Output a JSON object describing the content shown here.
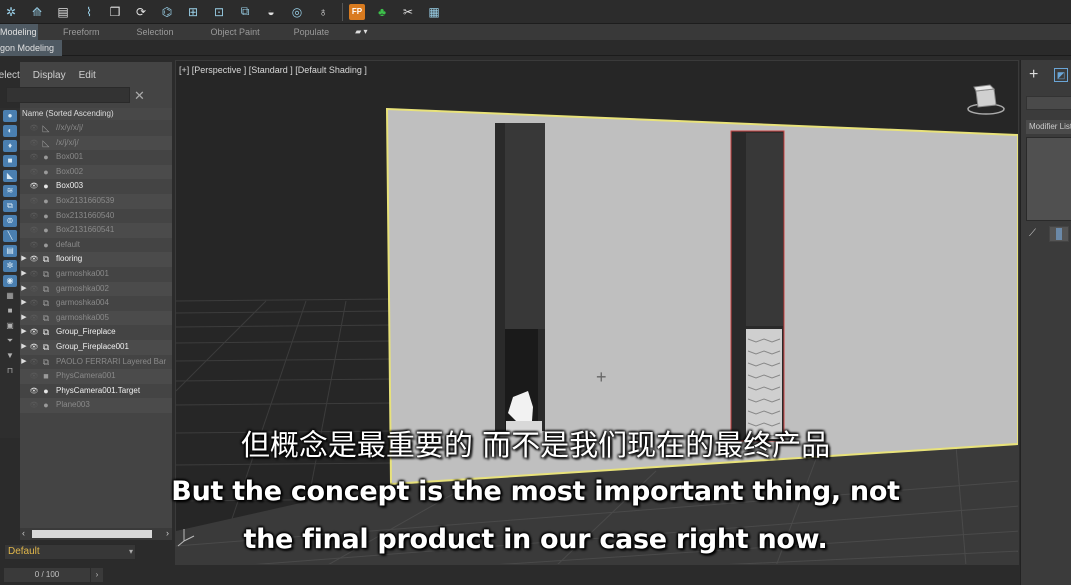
{
  "ribbon": {
    "tabs": [
      "Modeling",
      "Freeform",
      "Selection",
      "Object Paint",
      "Populate"
    ],
    "active_tab": "Modeling",
    "sub_tab": "gon Modeling"
  },
  "explorer": {
    "menu": [
      "Select",
      "Display",
      "Edit"
    ],
    "search_value": "",
    "column_header": "Name (Sorted Ascending)",
    "rows": [
      {
        "name": "//x/y/x/j/",
        "icon": "shape-icon",
        "visible": false,
        "expandable": false,
        "dim": true
      },
      {
        "name": "/x/j/x/j/",
        "icon": "shape-icon",
        "visible": false,
        "expandable": false,
        "dim": true
      },
      {
        "name": "Box001",
        "icon": "sphere-icon",
        "visible": false,
        "expandable": false,
        "dim": true
      },
      {
        "name": "Box002",
        "icon": "sphere-icon",
        "visible": false,
        "expandable": false,
        "dim": true
      },
      {
        "name": "Box003",
        "icon": "sphere-icon",
        "visible": true,
        "expandable": false,
        "dim": false
      },
      {
        "name": "Box2131660539",
        "icon": "sphere-icon",
        "visible": false,
        "expandable": false,
        "dim": true
      },
      {
        "name": "Box2131660540",
        "icon": "sphere-icon",
        "visible": false,
        "expandable": false,
        "dim": true
      },
      {
        "name": "Box2131660541",
        "icon": "sphere-icon",
        "visible": false,
        "expandable": false,
        "dim": true
      },
      {
        "name": "default",
        "icon": "sphere-icon",
        "visible": false,
        "expandable": false,
        "dim": true
      },
      {
        "name": "flooring",
        "icon": "group-icon",
        "visible": true,
        "expandable": true,
        "dim": false
      },
      {
        "name": "garmoshka001",
        "icon": "group-icon",
        "visible": false,
        "expandable": true,
        "dim": true
      },
      {
        "name": "garmoshka002",
        "icon": "group-icon",
        "visible": false,
        "expandable": true,
        "dim": true
      },
      {
        "name": "garmoshka004",
        "icon": "group-icon",
        "visible": false,
        "expandable": true,
        "dim": true
      },
      {
        "name": "garmoshka005",
        "icon": "group-icon",
        "visible": false,
        "expandable": true,
        "dim": true
      },
      {
        "name": "Group_Fireplace",
        "icon": "group-icon",
        "visible": true,
        "expandable": true,
        "dim": false
      },
      {
        "name": "Group_Fireplace001",
        "icon": "group-icon",
        "visible": true,
        "expandable": true,
        "dim": false
      },
      {
        "name": "PAOLO FERRARI Layered Bar",
        "icon": "group-icon",
        "visible": false,
        "expandable": true,
        "dim": true
      },
      {
        "name": "PhysCamera001",
        "icon": "camera-icon",
        "visible": false,
        "expandable": false,
        "dim": true
      },
      {
        "name": "PhysCamera001.Target",
        "icon": "target-icon",
        "visible": true,
        "expandable": false,
        "dim": false
      },
      {
        "name": "Plane003",
        "icon": "sphere-icon",
        "visible": false,
        "expandable": false,
        "dim": true
      }
    ],
    "layer": "Default",
    "timeline": "0 / 100"
  },
  "viewport": {
    "label": "[+] [Perspective ] [Standard ] [Default Shading ]"
  },
  "command_panel": {
    "modifier_list": "Modifier List"
  },
  "subtitles": {
    "zh": "但概念是最重要的 而不是我们现在的最终产品",
    "en_line1": "But the concept is the most important thing, not",
    "en_line2": "the final product in our case right now."
  },
  "colors": {
    "accent_blue": "#4a7fb0",
    "selection_yellow": "#e8e27a",
    "layer_text": "#e0b64a"
  }
}
